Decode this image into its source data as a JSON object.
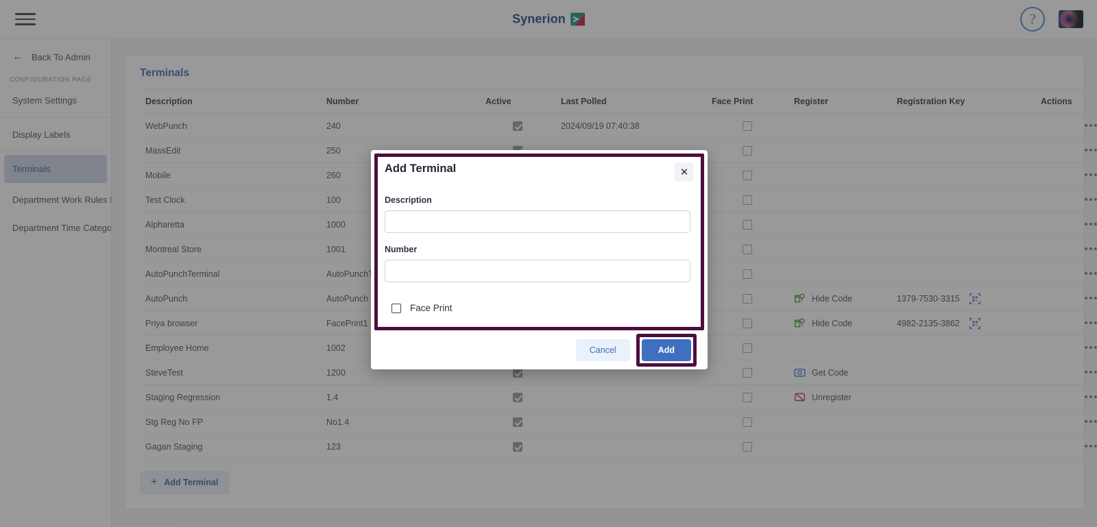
{
  "header": {
    "menu_icon": "hamburger-icon",
    "brand_name": "Synerion",
    "help_icon": "question-mark-icon",
    "avatar_icon": "user-avatar"
  },
  "sidebar": {
    "back_label": "Back To Admin",
    "section_caption": "CONFIGURATION PAGE",
    "items": [
      {
        "label": "System Settings",
        "active": false
      },
      {
        "label": "Display Labels",
        "active": false
      },
      {
        "label": "Terminals",
        "active": true
      },
      {
        "label": "Department Work Rules Filt...",
        "active": false
      },
      {
        "label": "Department Time Category ...",
        "active": false
      }
    ]
  },
  "main": {
    "card_title": "Terminals",
    "add_terminal_label": "Add Terminal",
    "columns": [
      "Description",
      "Number",
      "Active",
      "Last Polled",
      "Face Print",
      "Register",
      "Registration Key",
      "Actions"
    ],
    "rows": [
      {
        "description": "WebPunch",
        "number": "240",
        "active": true,
        "last_polled": "2024/09/19 07:40:38",
        "face_print": false,
        "register": "",
        "register_icon": "",
        "registration_key": "",
        "actions": "•••"
      },
      {
        "description": "MassEdit",
        "number": "250",
        "active": true,
        "last_polled": "",
        "face_print": false,
        "register": "",
        "register_icon": "",
        "registration_key": "",
        "actions": "•••"
      },
      {
        "description": "Mobile",
        "number": "260",
        "active": true,
        "last_polled": "",
        "face_print": false,
        "register": "",
        "register_icon": "",
        "registration_key": "",
        "actions": "•••"
      },
      {
        "description": "Test Clock",
        "number": "100",
        "active": true,
        "last_polled": "",
        "face_print": false,
        "register": "",
        "register_icon": "",
        "registration_key": "",
        "actions": "•••"
      },
      {
        "description": "Alpharetta",
        "number": "1000",
        "active": true,
        "last_polled": "",
        "face_print": false,
        "register": "",
        "register_icon": "",
        "registration_key": "",
        "actions": "•••"
      },
      {
        "description": "Montreal Store",
        "number": "1001",
        "active": true,
        "last_polled": "",
        "face_print": false,
        "register": "",
        "register_icon": "",
        "registration_key": "",
        "actions": "•••"
      },
      {
        "description": "AutoPunchTerminal",
        "number": "AutoPunchTe",
        "active": true,
        "last_polled": "",
        "face_print": false,
        "register": "",
        "register_icon": "",
        "registration_key": "",
        "actions": "•••"
      },
      {
        "description": "AutoPunch",
        "number": "AutoPunch",
        "active": true,
        "last_polled": "",
        "face_print": true,
        "register": "Hide Code",
        "register_icon": "hide-code-icon",
        "registration_key": "1379-7530-3315",
        "actions": "•••"
      },
      {
        "description": "Priya browser",
        "number": "FacePrint1",
        "active": true,
        "last_polled": "",
        "face_print": true,
        "register": "Hide Code",
        "register_icon": "hide-code-icon",
        "registration_key": "4982-2135-3862",
        "actions": "•••"
      },
      {
        "description": "Employee Home",
        "number": "1002",
        "active": true,
        "last_polled": "",
        "face_print": false,
        "register": "",
        "register_icon": "",
        "registration_key": "",
        "actions": "•••"
      },
      {
        "description": "SteveTest",
        "number": "1200",
        "active": true,
        "last_polled": "",
        "face_print": true,
        "register": "Get Code",
        "register_icon": "camera-icon",
        "registration_key": "",
        "actions": "•••"
      },
      {
        "description": "Staging Regression",
        "number": "1.4",
        "active": true,
        "last_polled": "",
        "face_print": true,
        "register": "Unregister",
        "register_icon": "unregister-icon",
        "registration_key": "",
        "actions": "•••"
      },
      {
        "description": "Stg Reg No FP",
        "number": "No1.4",
        "active": true,
        "last_polled": "",
        "face_print": false,
        "register": "",
        "register_icon": "",
        "registration_key": "",
        "actions": "•••"
      },
      {
        "description": "Gagan Staging",
        "number": "123",
        "active": true,
        "last_polled": "",
        "face_print": false,
        "register": "",
        "register_icon": "",
        "registration_key": "",
        "actions": "•••"
      }
    ]
  },
  "modal": {
    "title": "Add Terminal",
    "close_icon": "close-icon",
    "description_label": "Description",
    "description_value": "",
    "description_placeholder": "",
    "number_label": "Number",
    "number_value": "",
    "number_placeholder": "",
    "face_print_label": "Face Print",
    "face_print_checked": false,
    "cancel_label": "Cancel",
    "add_label": "Add"
  },
  "colors": {
    "brand_blue": "#14407e",
    "accent_blue": "#3f6fbf",
    "title_blue": "#2f63b0",
    "highlight_purple": "#4b0f3f",
    "register_green": "#4f9a34",
    "register_red": "#c0392b"
  }
}
